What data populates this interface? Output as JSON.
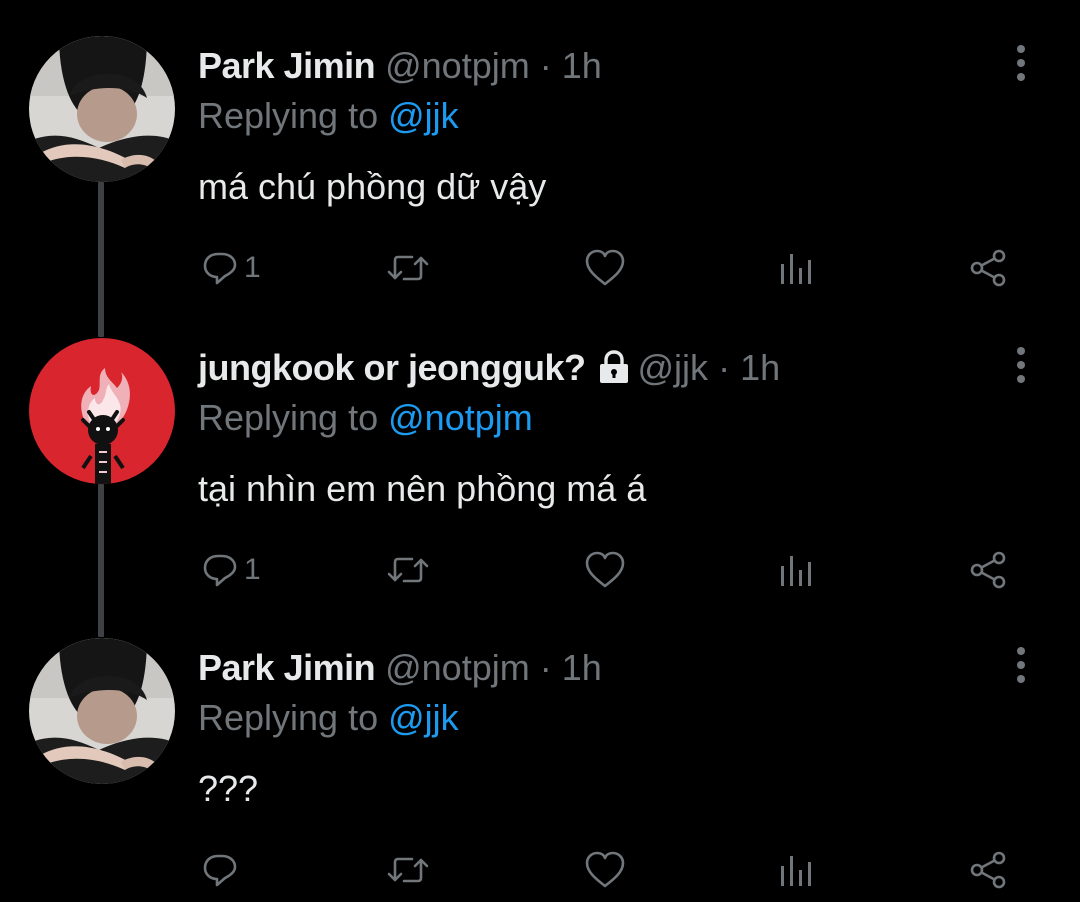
{
  "tweets": [
    {
      "display_name": "Park Jimin",
      "handle": "@notpjm",
      "separator": "·",
      "time": "1h",
      "replying_prefix": "Replying to",
      "replying_to": "@jjk",
      "text": "má chú phồng dữ vậy",
      "reply_count": "1",
      "avatar": "jimin-photo",
      "locked": false
    },
    {
      "display_name": "jungkook or jeongguk?",
      "handle": "@jjk",
      "separator": "·",
      "time": "1h",
      "replying_prefix": "Replying to",
      "replying_to": "@notpjm",
      "text": "tại nhìn em nên phồng má á",
      "reply_count": "1",
      "avatar": "red-flame-illustration",
      "locked": true
    },
    {
      "display_name": "Park Jimin",
      "handle": "@notpjm",
      "separator": "·",
      "time": "1h",
      "replying_prefix": "Replying to",
      "replying_to": "@jjk",
      "text": "???",
      "reply_count": "",
      "avatar": "jimin-photo",
      "locked": false
    }
  ],
  "icons": {
    "reply": "reply-icon",
    "retweet": "retweet-icon",
    "like": "heart-icon",
    "views": "analytics-icon",
    "share": "share-icon",
    "more": "more-vertical-icon",
    "lock": "lock-icon"
  },
  "colors": {
    "background": "#000000",
    "text_primary": "#e7e9ea",
    "text_secondary": "#71767b",
    "accent": "#1d9bf0",
    "thread_line": "#3e4144",
    "avatar_red": "#d9252e"
  }
}
